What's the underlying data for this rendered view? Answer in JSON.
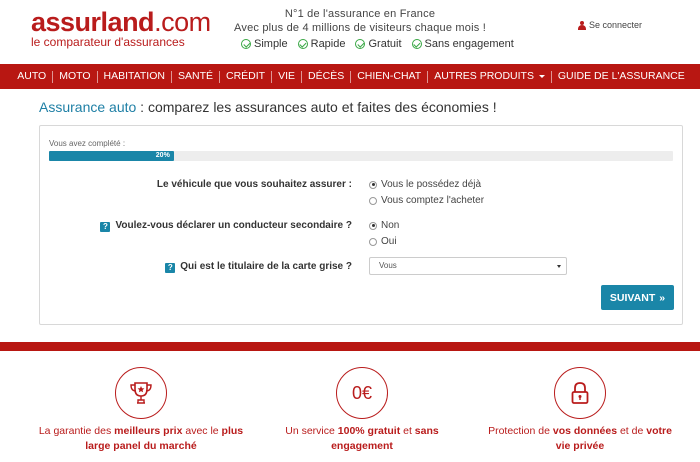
{
  "logo": {
    "main": "assurland",
    "dotcom": ".com",
    "tagline": "le comparateur d'assurances"
  },
  "header": {
    "line1": "N°1 de l'assurance en France",
    "line2": "Avec plus de 4 millions de visiteurs chaque mois !",
    "benefits": [
      "Simple",
      "Rapide",
      "Gratuit",
      "Sans engagement"
    ],
    "login": "Se connecter"
  },
  "nav": {
    "items": [
      "AUTO",
      "MOTO",
      "HABITATION",
      "SANTÉ",
      "CRÉDIT",
      "VIE",
      "DÉCÈS",
      "CHIEN-CHAT",
      "AUTRES PRODUITS",
      "GUIDE DE L'ASSURANCE"
    ]
  },
  "title": {
    "highlight": "Assurance auto",
    "rest": " : comparez les assurances auto et faites des économies !"
  },
  "form": {
    "progress_label": "Vous avez complété :",
    "progress_value": 0.2,
    "progress_text": "20%",
    "q1": {
      "label": "Le véhicule que vous souhaitez assurer :",
      "options": [
        "Vous le possédez déjà",
        "Vous comptez l'acheter"
      ],
      "selected": 0
    },
    "q2": {
      "label": "Voulez-vous déclarer un conducteur secondaire ?",
      "options": [
        "Non",
        "Oui"
      ],
      "selected": 0
    },
    "q3": {
      "label": "Qui est le titulaire de la carte grise ?",
      "select_value": "Vous"
    },
    "help_symbol": "?",
    "next_label": "SUIVANT",
    "next_icon": "»"
  },
  "features": {
    "f1": {
      "pre": "La garantie des ",
      "b1": "meilleurs prix",
      "mid": " avec le ",
      "b2": "plus large panel du marché"
    },
    "f2": {
      "pre": "Un service ",
      "b1": "100% gratuit",
      "mid": " et ",
      "b2": "sans engagement"
    },
    "f3": {
      "pre": "Protection de ",
      "b1": "vos données",
      "mid": " et de ",
      "b2": "votre vie privée"
    },
    "euro_text": "0€"
  },
  "colors": {
    "brand_red": "#b81712",
    "accent_blue": "#1a86a8",
    "check_green": "#3aa845"
  }
}
